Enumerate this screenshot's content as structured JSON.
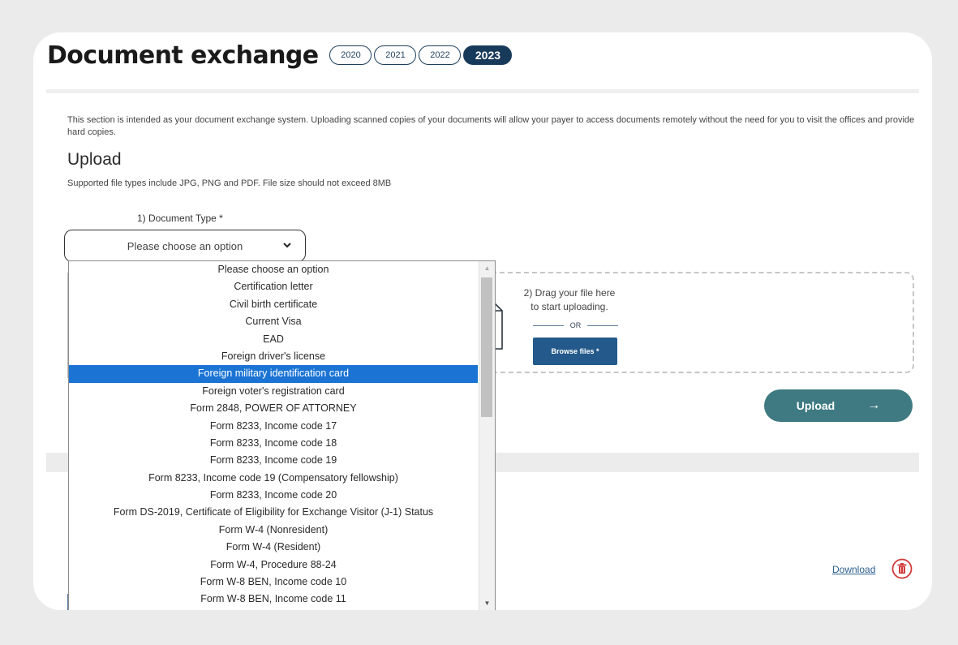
{
  "page": {
    "title": "Document exchange",
    "years": [
      "2020",
      "2021",
      "2022",
      "2023"
    ],
    "active_year": "2023"
  },
  "upload_section": {
    "intro": "This section is intended as your document exchange system. Uploading scanned copies of your documents will allow your payer to access documents remotely without the need for you to visit the offices and provide hard copies.",
    "title": "Upload",
    "subtitle": "Supported file types include JPG, PNG and PDF. File size should not exceed 8MB",
    "document_type_label": "1) Document Type *",
    "select_value": "Please choose an option",
    "drag_text_1": "2) Drag your file here",
    "drag_text_2": "to start uploading.",
    "or_text": "OR",
    "browse_label": "Browse files *",
    "upload_label": "Upload",
    "upload_arrow": "→"
  },
  "dropdown": {
    "selected": "Foreign military identification card",
    "options": [
      "Please choose an option",
      "Certification letter",
      "Civil birth certificate",
      "Current Visa",
      "EAD",
      "Foreign driver's license",
      "Foreign military identification card",
      "Foreign voter's registration card",
      "Form 2848, POWER OF ATTORNEY",
      "Form 8233, Income code 17",
      "Form 8233, Income code 18",
      "Form 8233, Income code 19",
      "Form 8233, Income code 19 (Compensatory fellowship)",
      "Form 8233, Income code 20",
      "Form DS-2019, Certificate of Eligibility for Exchange Visitor (J-1) Status",
      "Form W-4 (Nonresident)",
      "Form W-4 (Resident)",
      "Form W-4, Procedure 88-24",
      "Form W-8 BEN, Income code 10",
      "Form W-8 BEN, Income code 11"
    ]
  },
  "documents_section": {
    "download_label": "Download"
  },
  "icons": {
    "chevron": "chevron-down-icon",
    "file_add": "file-add-icon",
    "trash": "trash-icon",
    "arrow": "arrow-right-icon"
  },
  "colors": {
    "active_year_bg": "#17395a",
    "browse_bg": "#245a8b",
    "upload_bg": "#3f7a82",
    "selected_option_bg": "#1b74d4",
    "trash_red": "#d23a3a"
  }
}
